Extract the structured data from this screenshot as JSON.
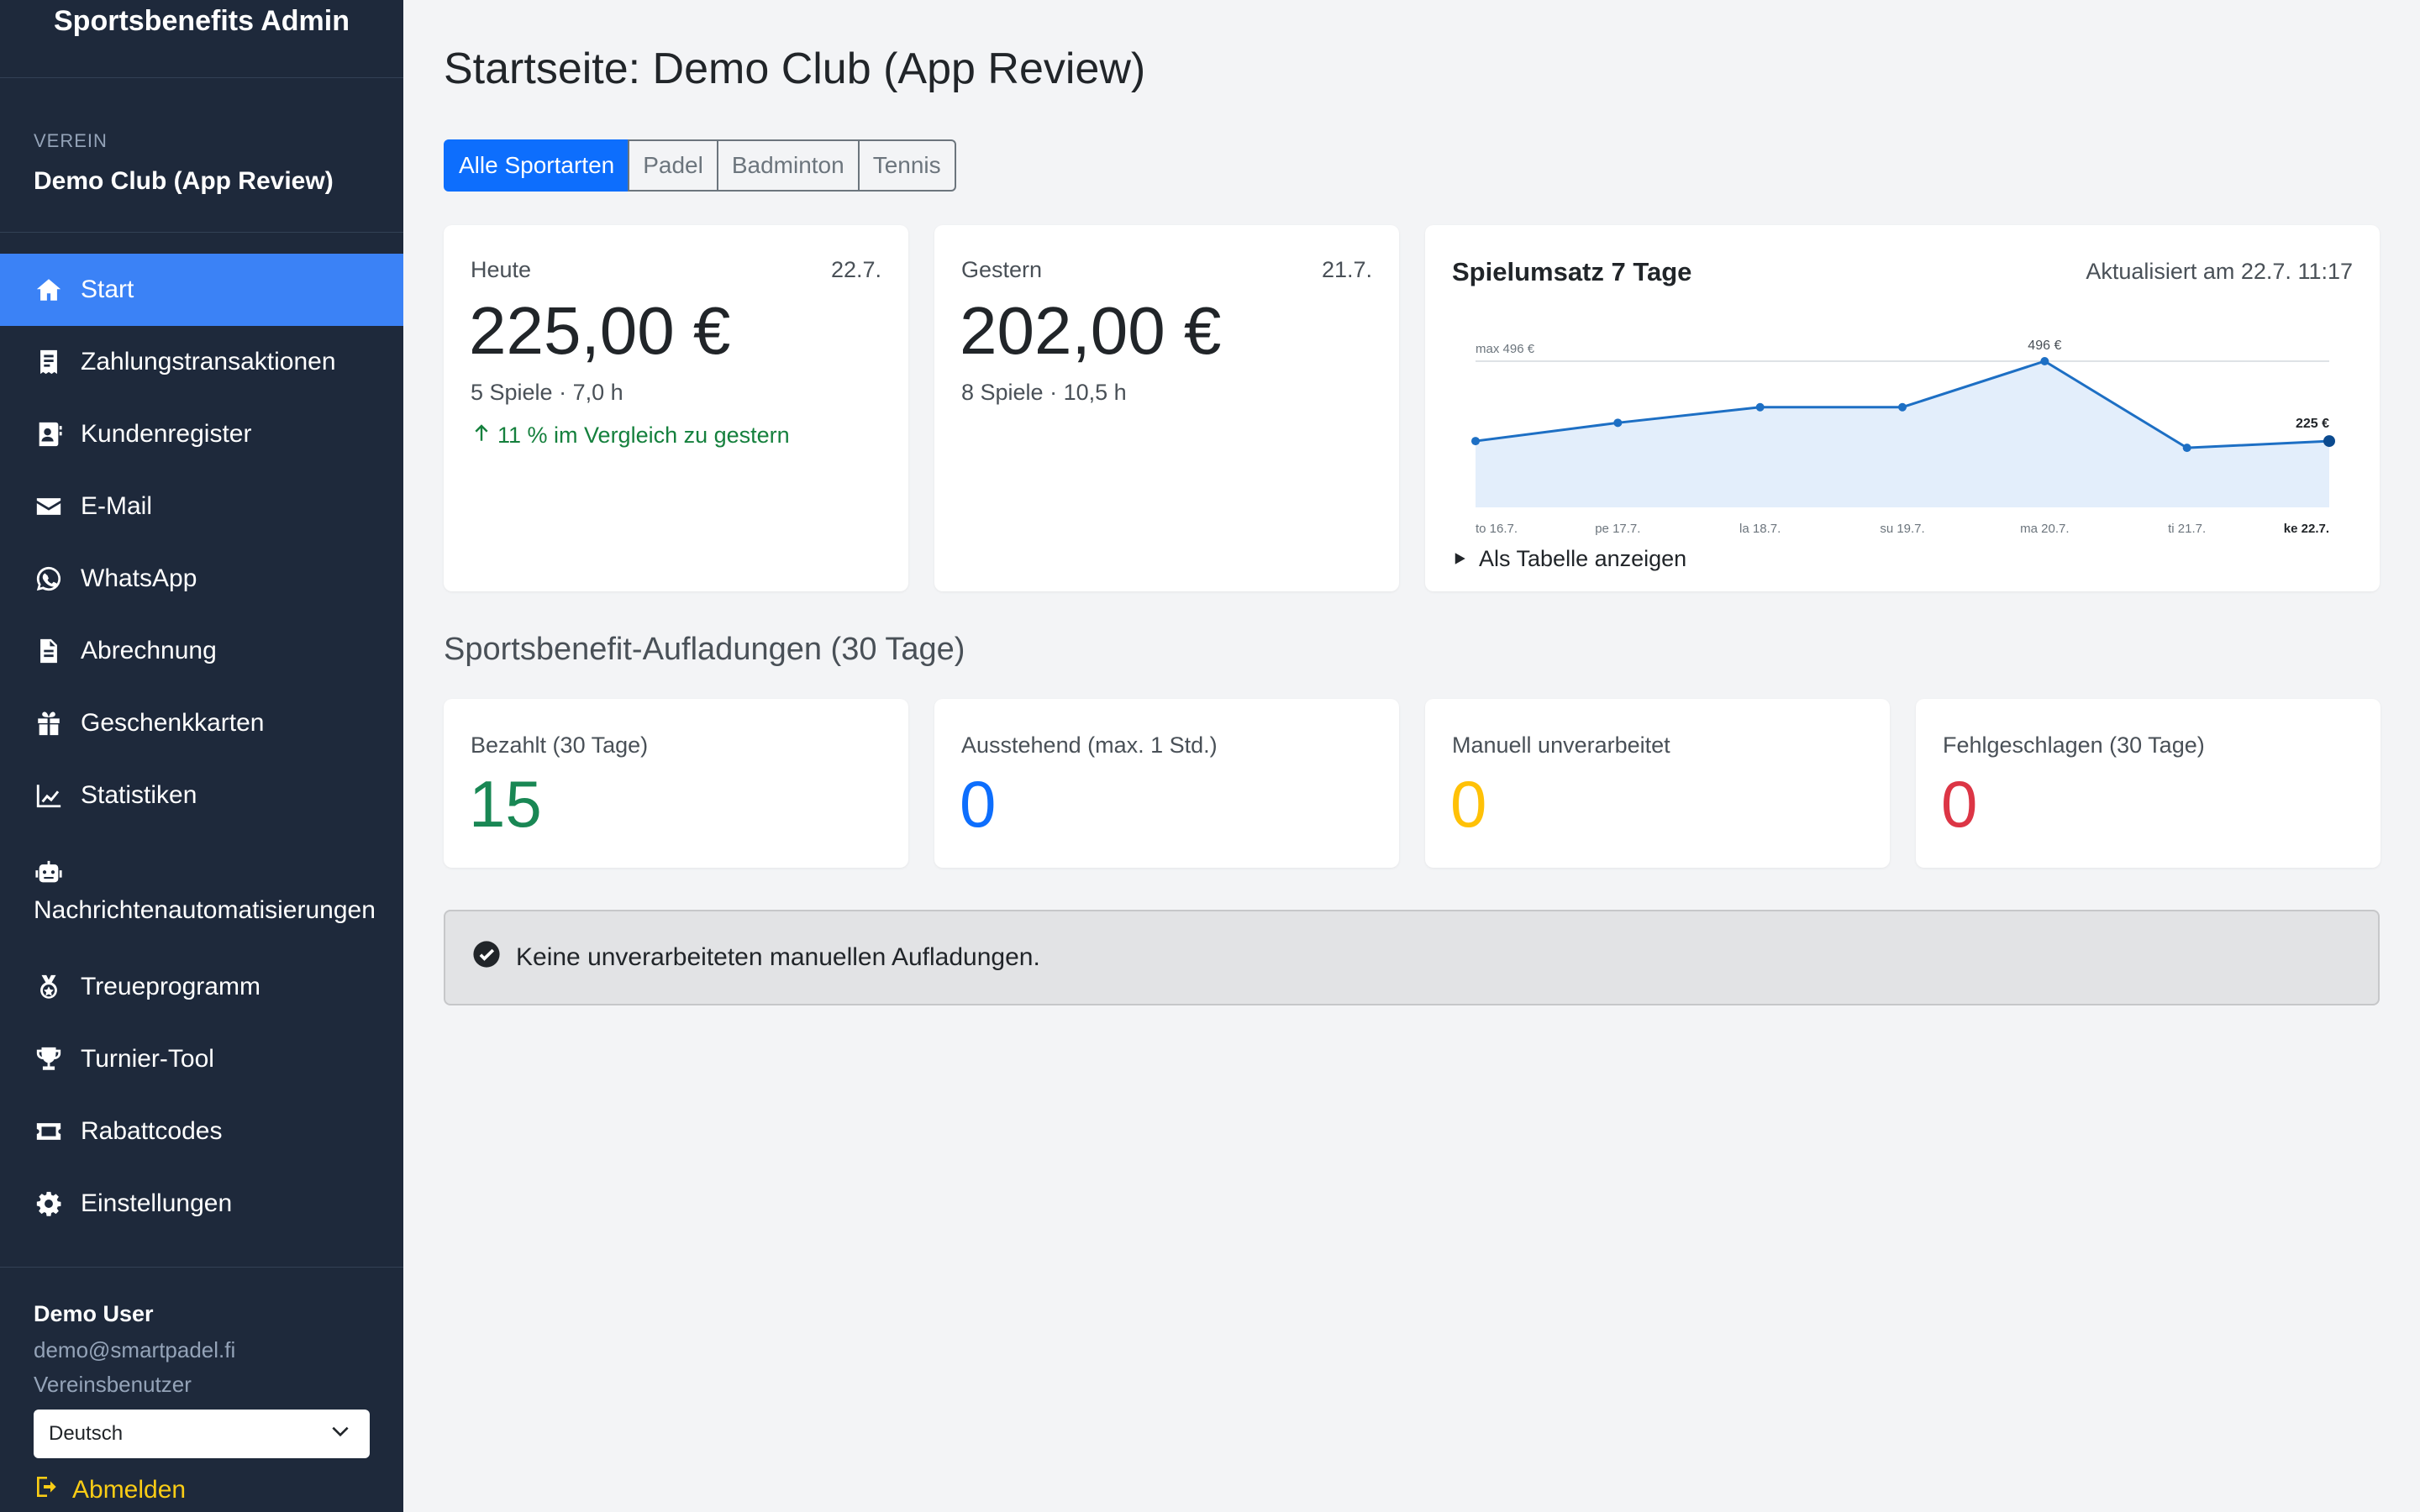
{
  "sidebar": {
    "brand": "Sportsbenefits Admin",
    "club_label": "VEREIN",
    "club_name": "Demo Club (App Review)",
    "items": [
      {
        "label": "Start",
        "icon": "home-icon",
        "active": true
      },
      {
        "label": "Zahlungstransaktionen",
        "icon": "receipt-icon"
      },
      {
        "label": "Kundenregister",
        "icon": "contact-card-icon"
      },
      {
        "label": "E-Mail",
        "icon": "envelope-icon"
      },
      {
        "label": "WhatsApp",
        "icon": "whatsapp-icon"
      },
      {
        "label": "Abrechnung",
        "icon": "document-icon"
      },
      {
        "label": "Geschenkkarten",
        "icon": "gift-icon"
      },
      {
        "label": "Statistiken",
        "icon": "line-chart-icon"
      },
      {
        "label": "Nachrichtenautomatisierungen",
        "icon": "robot-icon"
      },
      {
        "label": "Treueprogramm",
        "icon": "medal-icon"
      },
      {
        "label": "Turnier-Tool",
        "icon": "trophy-icon"
      },
      {
        "label": "Rabattcodes",
        "icon": "ticket-icon"
      },
      {
        "label": "Einstellungen",
        "icon": "gear-icon"
      }
    ],
    "user": {
      "name": "Demo User",
      "email": "demo@smartpadel.fi",
      "role": "Vereinsbenutzer",
      "language": "Deutsch",
      "logout": "Abmelden"
    }
  },
  "main": {
    "title": "Startseite: Demo Club (App Review)",
    "tabs": [
      "Alle Sportarten",
      "Padel",
      "Badminton",
      "Tennis"
    ],
    "today": {
      "label": "Heute",
      "date": "22.7.",
      "value": "225,00 €",
      "sub": "5 Spiele · 7,0 h",
      "trend": "11 % im Vergleich zu gestern"
    },
    "yesterday": {
      "label": "Gestern",
      "date": "21.7.",
      "value": "202,00 €",
      "sub": "8 Spiele · 10,5 h"
    },
    "chart_card": {
      "title": "Spielumsatz 7 Tage",
      "updated": "Aktualisiert am 22.7. 11:17",
      "table_toggle": "Als Tabelle anzeigen"
    },
    "section_title": "Sportsbenefit-Aufladungen (30 Tage)",
    "stats": [
      {
        "label": "Bezahlt (30 Tage)",
        "value": "15",
        "color": "#198754"
      },
      {
        "label": "Ausstehend (max. 1 Std.)",
        "value": "0",
        "color": "#0d6efd"
      },
      {
        "label": "Manuell unverarbeitet",
        "value": "0",
        "color": "#ffc107"
      },
      {
        "label": "Fehlgeschlagen (30 Tage)",
        "value": "0",
        "color": "#dc3545"
      }
    ],
    "alert": "Keine unverarbeiteten manuellen Aufladungen."
  },
  "chart_data": {
    "type": "area",
    "categories": [
      "to 16.7.",
      "pe 17.7.",
      "la 18.7.",
      "su 19.7.",
      "ma 20.7.",
      "ti 21.7.",
      "ke 22.7."
    ],
    "values": [
      225,
      287,
      340,
      340,
      496,
      202,
      225
    ],
    "max_label": "max 496 €",
    "peak_label": "496 €",
    "last_label": "225 €",
    "ylim": [
      0,
      496
    ],
    "line_color": "#1d6fc4",
    "fill_color": "#e3eefb",
    "grid": false,
    "legend": "none"
  }
}
